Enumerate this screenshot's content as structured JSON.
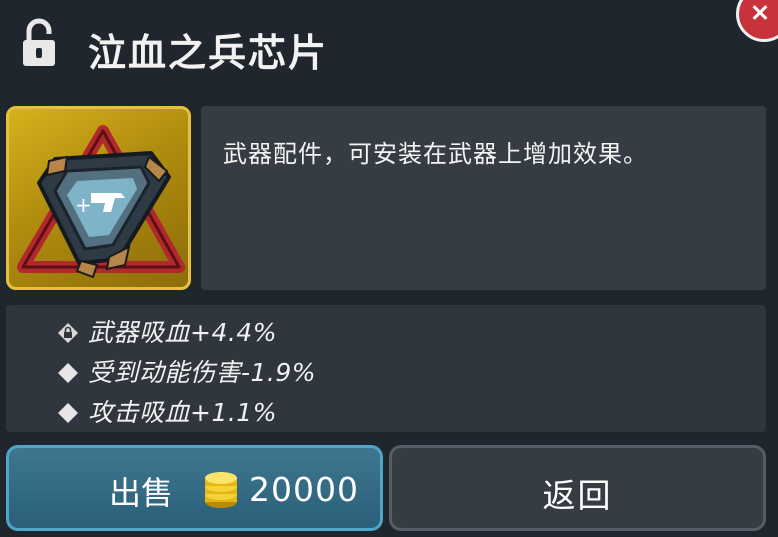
{
  "header": {
    "title": "泣血之兵芯片",
    "lock_icon": "unlocked-padlock-icon",
    "close_icon": "close-icon"
  },
  "item": {
    "icon": "weapon-chip-icon",
    "rarity_color": "#d5b21d",
    "description": "武器配件，可安装在武器上增加效果。"
  },
  "stats": [
    {
      "marker": "lock-diamond-icon",
      "text": "武器吸血+4.4%"
    },
    {
      "marker": "diamond-icon",
      "text": "受到动能伤害-1.9%"
    },
    {
      "marker": "diamond-icon",
      "text": "攻击吸血+1.1%"
    }
  ],
  "actions": {
    "sell_label": "出售",
    "sell_price": "20000",
    "coin_icon": "gold-coin-stack-icon",
    "back_label": "返回"
  }
}
